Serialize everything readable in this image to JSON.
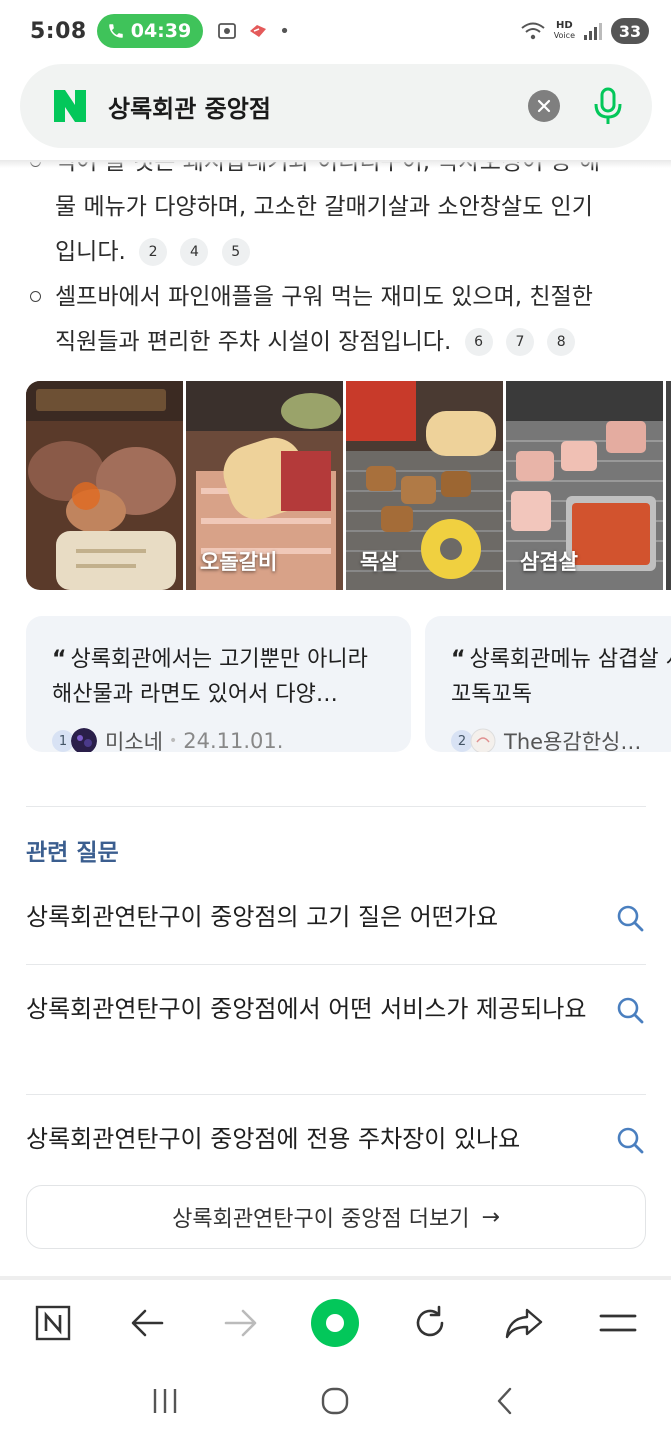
{
  "status_bar": {
    "time": "5:08",
    "call_duration": "04:39",
    "hd_label": "HD",
    "voice_label": "Voice",
    "battery": "33"
  },
  "search": {
    "query": "상록회관 중앙점"
  },
  "answer": {
    "bullets": [
      {
        "line1": "먹어 볼 것은 돼지갑데기와 이리디구이, 득자오징어 등 해",
        "line2": "물 메뉴가 다양하며, 고소한 갈매기살과 소안창살도 인기",
        "line3": "입니다.",
        "cites": [
          "2",
          "4",
          "5"
        ]
      },
      {
        "line1": "셀프바에서 파인애플을 구워 먹는 재미도 있으며, 친절한",
        "line2": "직원들과 편리한 주차 시설이 장점입니다.",
        "cites": [
          "6",
          "7",
          "8"
        ]
      }
    ]
  },
  "images": [
    {
      "label": ""
    },
    {
      "label": "오돌갈비"
    },
    {
      "label": "목살"
    },
    {
      "label": "삼겹살"
    }
  ],
  "reviews": [
    {
      "quote": "상록회관에서는 고기뿐만 아니라 해산물과 라면도 있어서 다양…",
      "num": "1",
      "author": "미소네",
      "date": "24.11.01."
    },
    {
      "quote": "상록회관메뉴 삼겹살 서 갈매기살과 꼬독꼬독",
      "num": "2",
      "author": "The용감한싱…",
      "date": ""
    }
  ],
  "related": {
    "title": "관련 질문",
    "questions": [
      "상록회관연탄구이 중앙점의 고기 질은 어떤가요",
      "상록회관연탄구이 중앙점에서 어떤 서비스가 제공되나요",
      "상록회관연탄구이 중앙점에 전용 주차장이 있나요"
    ],
    "more_label": "상록회관연탄구이 중앙점 더보기",
    "more_arrow": "→"
  },
  "colors": {
    "naver_green": "#03c75a",
    "call_green": "#3fc35a",
    "question_blue": "#3b5e8f",
    "search_icon": "#4a7fbf"
  },
  "icons": {
    "toolbar": [
      "naver-home-icon",
      "back-arrow-icon",
      "forward-arrow-icon",
      "green-dot-icon",
      "refresh-icon",
      "share-icon",
      "menu-icon"
    ],
    "nav": [
      "recent-apps-icon",
      "home-circle-icon",
      "system-back-icon"
    ]
  }
}
